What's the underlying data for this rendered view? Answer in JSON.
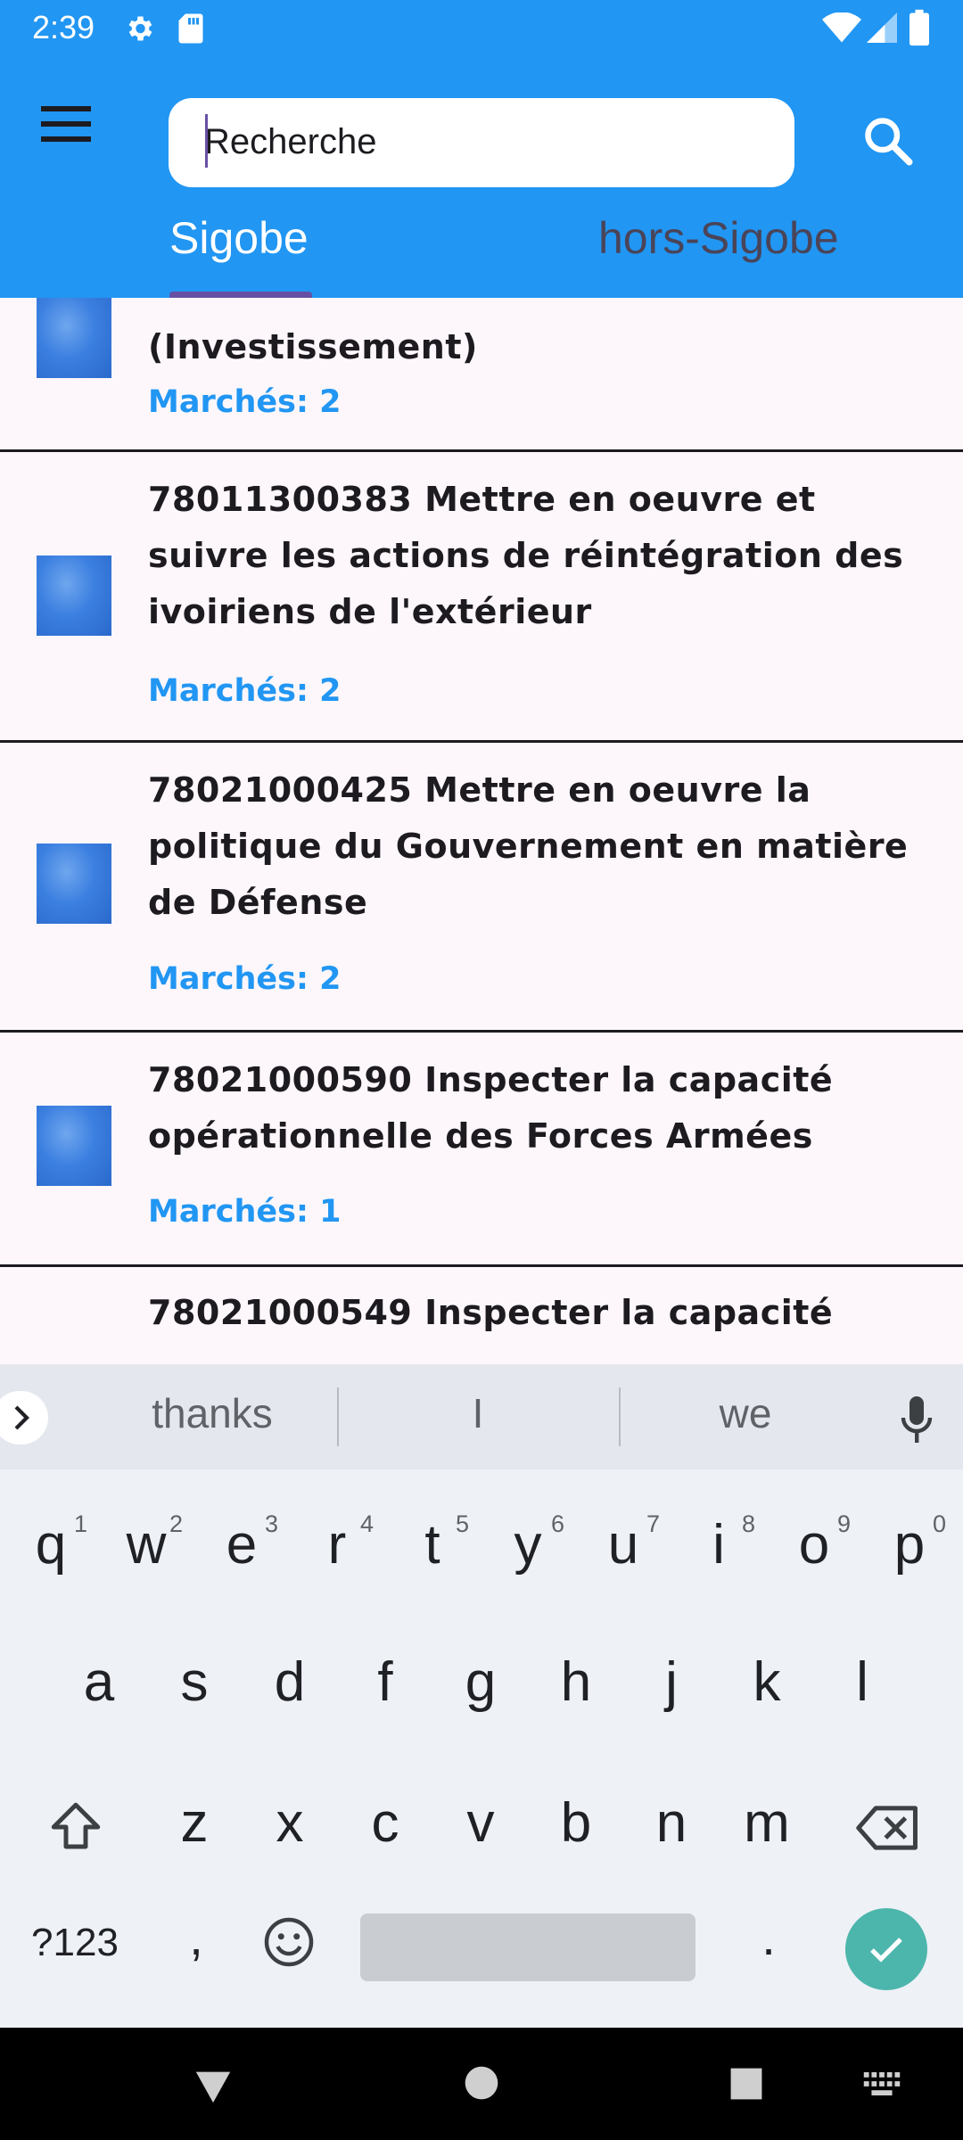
{
  "status_bar": {
    "time": "2:39",
    "icons": [
      "gear-icon",
      "sd-card-icon",
      "wifi-icon",
      "signal-icon",
      "battery-icon"
    ]
  },
  "header": {
    "menu_icon": "hamburger-menu-icon",
    "search": {
      "placeholder": "Recherche",
      "value": ""
    },
    "search_icon": "search-icon",
    "tabs": [
      {
        "label": "Sigobe",
        "selected": true
      },
      {
        "label": "hors-Sigobe",
        "selected": false
      }
    ]
  },
  "list": {
    "items": [
      {
        "title": "(Investissement)",
        "count": "Marchés: 2"
      },
      {
        "title": "78011300383 Mettre en oeuvre et suivre les actions de réintégration des ivoiriens de l'extérieur",
        "count": "Marchés: 2"
      },
      {
        "title": "78021000425 Mettre en oeuvre la politique du Gouvernement en matière de Défense",
        "count": "Marchés: 2"
      },
      {
        "title": "78021000590 Inspecter la capacité opérationnelle des Forces Armées",
        "count": "Marchés: 1"
      },
      {
        "title": "78021000549 Inspecter la capacité",
        "count": ""
      }
    ]
  },
  "keyboard": {
    "suggestions": [
      "thanks",
      "I",
      "we"
    ],
    "row1": [
      {
        "key": "q",
        "hint": "1"
      },
      {
        "key": "w",
        "hint": "2"
      },
      {
        "key": "e",
        "hint": "3"
      },
      {
        "key": "r",
        "hint": "4"
      },
      {
        "key": "t",
        "hint": "5"
      },
      {
        "key": "y",
        "hint": "6"
      },
      {
        "key": "u",
        "hint": "7"
      },
      {
        "key": "i",
        "hint": "8"
      },
      {
        "key": "o",
        "hint": "9"
      },
      {
        "key": "p",
        "hint": "0"
      }
    ],
    "row2": [
      "a",
      "s",
      "d",
      "f",
      "g",
      "h",
      "j",
      "k",
      "l"
    ],
    "row3": [
      "z",
      "x",
      "c",
      "v",
      "b",
      "n",
      "m"
    ],
    "symbols_label": "?123",
    "comma": ",",
    "period": ".",
    "emoji_icon": "emoji-icon",
    "shift_icon": "shift-icon",
    "backspace_icon": "backspace-icon",
    "enter_icon": "check-icon",
    "colors": {
      "enter": "#4db6ac",
      "background": "#eef1f6"
    }
  },
  "nav_bar": {
    "icons": [
      "back-icon",
      "home-icon",
      "recents-icon",
      "keyboard-switch-icon"
    ]
  },
  "theme": {
    "primary": "#2196f3",
    "indicator": "#6750a4",
    "count_color": "#2196f3"
  }
}
